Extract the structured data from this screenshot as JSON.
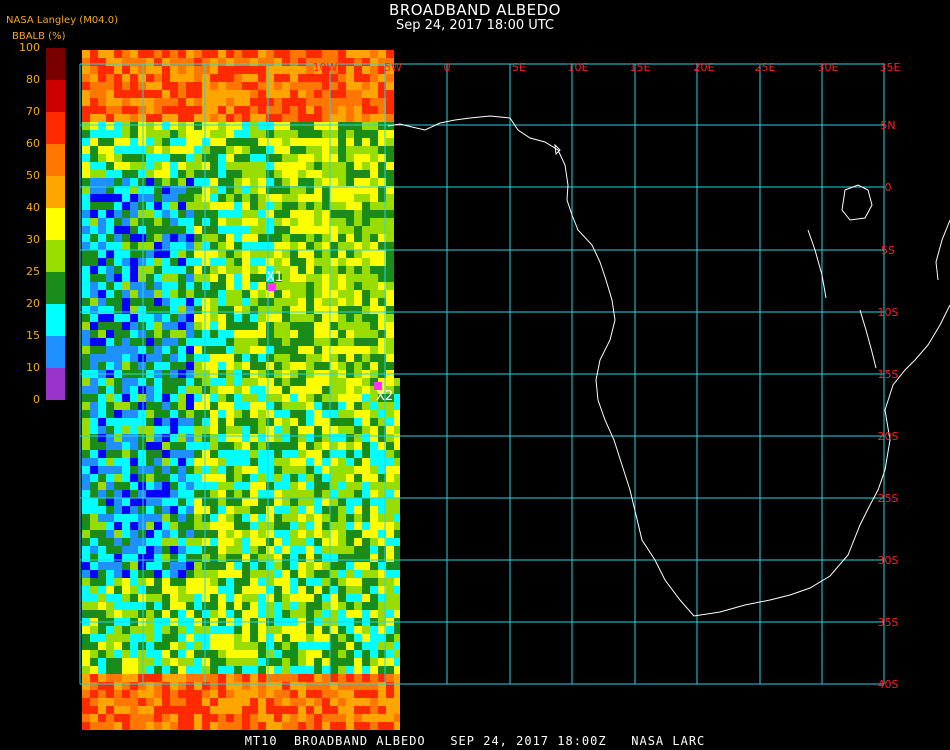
{
  "header": {
    "title": "BROADBAND ALBEDO",
    "datetime": "Sep 24, 2017 18:00 UTC",
    "producer": "NASA Langley (M04.0)"
  },
  "colorbar": {
    "title": "BBALB (%)",
    "labels": [
      "100",
      "80",
      "70",
      "60",
      "50",
      "40",
      "30",
      "25",
      "20",
      "15",
      "10",
      "0"
    ],
    "colors": [
      "#7a0000",
      "#cc0000",
      "#ff2a00",
      "#ff7700",
      "#ffa500",
      "#ffff00",
      "#99dd00",
      "#1a8c1a",
      "#00ffff",
      "#1e90ff",
      "#0000ff",
      "#9933cc"
    ]
  },
  "grid": {
    "lon_labels": [
      "10W",
      "5W",
      "0",
      "5E",
      "10E",
      "15E",
      "20E",
      "25E",
      "30E",
      "35E"
    ],
    "lat_labels": [
      "5N",
      "0",
      "5S",
      "10S",
      "15S",
      "20S",
      "25S",
      "30S",
      "35S",
      "40S"
    ],
    "line_color": "#29d3e0",
    "label_color": "#ff2020"
  },
  "markers": [
    {
      "label": "X1",
      "color": "#ff33ff"
    },
    {
      "label": "X2",
      "color": "#ff33ff"
    }
  ],
  "footer": "MT10  BROADBAND ALBEDO   SEP 24, 2017 18:00Z   NASA LARC"
}
